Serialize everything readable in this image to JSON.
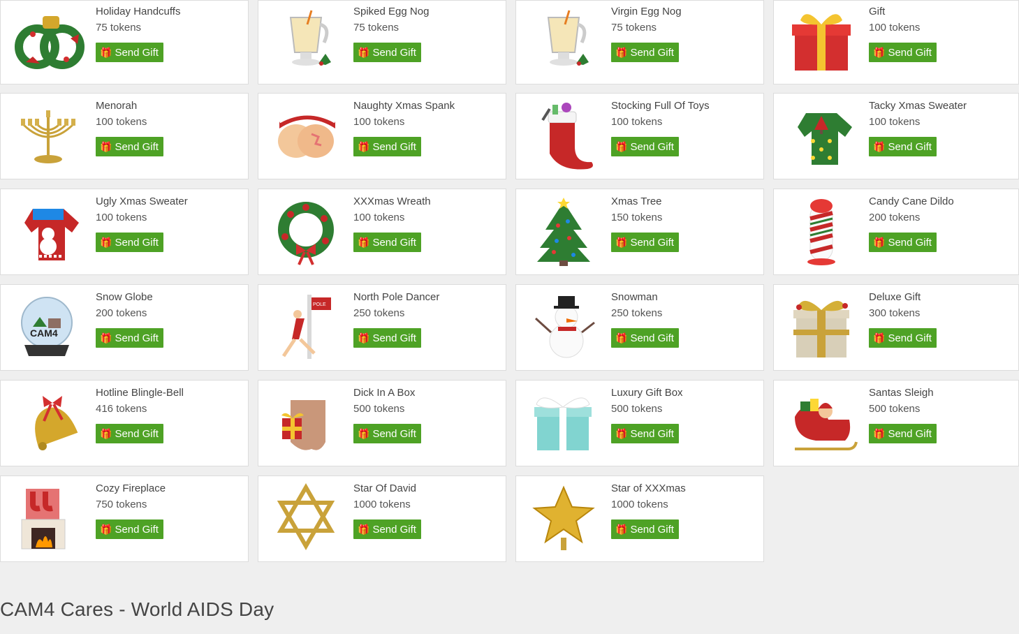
{
  "send_gift_label": "Send Gift",
  "gift_icon_glyph": "🎁",
  "accent_color": "#4ea225",
  "gifts": [
    {
      "name": "Holiday Handcuffs",
      "price": "75 tokens",
      "icon": "handcuffs-wreath-icon"
    },
    {
      "name": "Spiked Egg Nog",
      "price": "75 tokens",
      "icon": "egg-nog-mug-icon"
    },
    {
      "name": "Virgin Egg Nog",
      "price": "75 tokens",
      "icon": "egg-nog-mug-icon"
    },
    {
      "name": "Gift",
      "price": "100 tokens",
      "icon": "gift-box-icon"
    },
    {
      "name": "Menorah",
      "price": "100 tokens",
      "icon": "menorah-icon"
    },
    {
      "name": "Naughty Xmas Spank",
      "price": "100 tokens",
      "icon": "spank-icon"
    },
    {
      "name": "Stocking Full Of Toys",
      "price": "100 tokens",
      "icon": "stocking-icon"
    },
    {
      "name": "Tacky Xmas Sweater",
      "price": "100 tokens",
      "icon": "green-sweater-icon"
    },
    {
      "name": "Ugly Xmas Sweater",
      "price": "100 tokens",
      "icon": "red-sweater-icon"
    },
    {
      "name": "XXXmas Wreath",
      "price": "100 tokens",
      "icon": "wreath-icon"
    },
    {
      "name": "Xmas Tree",
      "price": "150 tokens",
      "icon": "xmas-tree-icon"
    },
    {
      "name": "Candy Cane Dildo",
      "price": "200 tokens",
      "icon": "candy-cane-toy-icon"
    },
    {
      "name": "Snow Globe",
      "price": "200 tokens",
      "icon": "snow-globe-icon"
    },
    {
      "name": "North Pole Dancer",
      "price": "250 tokens",
      "icon": "pole-dancer-icon"
    },
    {
      "name": "Snowman",
      "price": "250 tokens",
      "icon": "snowman-icon"
    },
    {
      "name": "Deluxe Gift",
      "price": "300 tokens",
      "icon": "deluxe-gift-icon"
    },
    {
      "name": "Hotline Blingle-Bell",
      "price": "416 tokens",
      "icon": "bell-icon"
    },
    {
      "name": "Dick In A Box",
      "price": "500 tokens",
      "icon": "box-torso-icon"
    },
    {
      "name": "Luxury Gift Box",
      "price": "500 tokens",
      "icon": "luxury-gift-box-icon"
    },
    {
      "name": "Santas Sleigh",
      "price": "500 tokens",
      "icon": "sleigh-icon"
    },
    {
      "name": "Cozy Fireplace",
      "price": "750 tokens",
      "icon": "fireplace-icon"
    },
    {
      "name": "Star Of David",
      "price": "1000 tokens",
      "icon": "star-of-david-icon"
    },
    {
      "name": "Star of XXXmas",
      "price": "1000 tokens",
      "icon": "gold-star-icon"
    }
  ],
  "section_title": "CAM4 Cares - World AIDS Day"
}
